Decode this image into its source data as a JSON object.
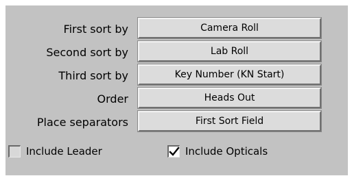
{
  "sort": {
    "first_label": "First sort by",
    "first_value": "Camera Roll",
    "second_label": "Second sort by",
    "second_value": "Lab Roll",
    "third_label": "Third sort by",
    "third_value": "Key Number (KN Start)",
    "order_label": "Order",
    "order_value": "Heads Out",
    "separators_label": "Place separators",
    "separators_value": "First Sort Field"
  },
  "options": {
    "include_leader_label": "Include Leader",
    "include_leader_checked": false,
    "include_opticals_label": "Include Opticals",
    "include_opticals_checked": true
  }
}
